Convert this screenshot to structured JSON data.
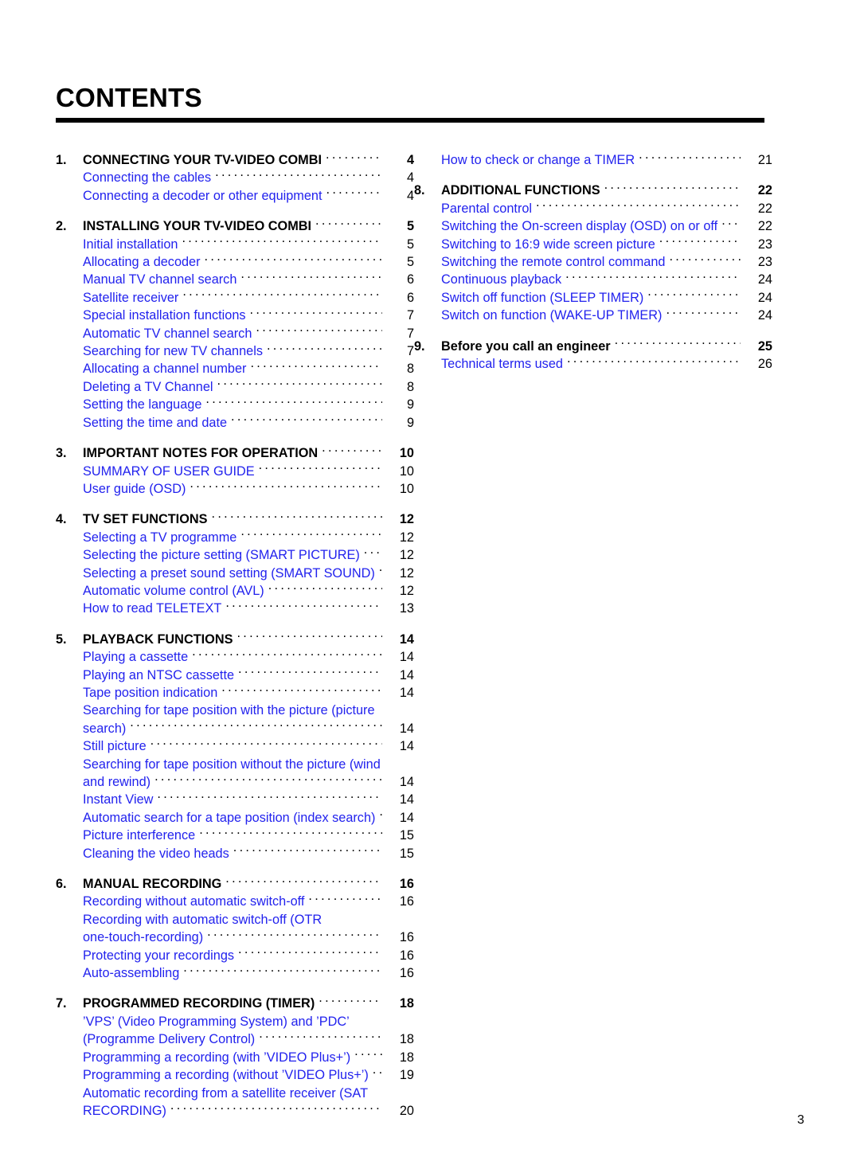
{
  "document": {
    "title": "CONTENTS",
    "folio": "3",
    "accent_blue": "#2222ee",
    "text_black": "#000000"
  },
  "columns": {
    "left": [
      {
        "number": "1.",
        "label": "CONNECTING YOUR TV-VIDEO COMBI",
        "page": "4",
        "items": [
          {
            "label": "Connecting the cables",
            "page": "4"
          },
          {
            "label": "Connecting a decoder or other equipment",
            "page": "4"
          }
        ]
      },
      {
        "number": "2.",
        "label": "INSTALLING YOUR TV-VIDEO COMBI",
        "page": "5",
        "items": [
          {
            "label": "Initial installation",
            "page": "5"
          },
          {
            "label": "Allocating a decoder",
            "page": "5"
          },
          {
            "label": "Manual TV channel search",
            "page": "6"
          },
          {
            "label": "Satellite receiver",
            "page": "6"
          },
          {
            "label": "Special installation functions",
            "page": "7"
          },
          {
            "label": "Automatic TV channel search",
            "page": "7"
          },
          {
            "label": "Searching for new TV channels",
            "page": "7"
          },
          {
            "label": "Allocating a channel number",
            "page": "8"
          },
          {
            "label": "Deleting a TV Channel",
            "page": "8"
          },
          {
            "label": "Setting the language",
            "page": "9"
          },
          {
            "label": "Setting the time and date",
            "page": "9"
          }
        ]
      },
      {
        "number": "3.",
        "label": "IMPORTANT NOTES FOR OPERATION",
        "page": "10",
        "items": [
          {
            "label": "SUMMARY OF USER GUIDE",
            "page": "10"
          },
          {
            "label": "User guide (OSD)",
            "page": "10"
          }
        ]
      },
      {
        "number": "4.",
        "label": "TV SET FUNCTIONS",
        "page": "12",
        "items": [
          {
            "label": "Selecting a TV programme",
            "page": "12"
          },
          {
            "label": "Selecting the picture setting (SMART PICTURE)",
            "page": "12"
          },
          {
            "label": "Selecting a preset sound setting (SMART SOUND)",
            "page": "12"
          },
          {
            "label": "Automatic volume control (AVL)",
            "page": "12"
          },
          {
            "label": "How to read TELETEXT",
            "page": "13"
          }
        ]
      },
      {
        "number": "5.",
        "label": "PLAYBACK FUNCTIONS",
        "page": "14",
        "items": [
          {
            "label": "Playing a cassette",
            "page": "14"
          },
          {
            "label": "Playing an NTSC cassette",
            "page": "14"
          },
          {
            "label": "Tape position indication",
            "page": "14"
          },
          {
            "label": "Searching for tape position with the picture (picture",
            "page": "",
            "wrap_first": true
          },
          {
            "label": "search)",
            "page": "14"
          },
          {
            "label": "Still picture",
            "page": "14"
          },
          {
            "label": "Searching for tape position without the picture (wind",
            "page": "",
            "wrap_first": true
          },
          {
            "label": "and rewind)",
            "page": "14"
          },
          {
            "label": "Instant View",
            "page": "14"
          },
          {
            "label": "Automatic search for a tape position (index search)",
            "page": "14"
          },
          {
            "label": "Picture interference",
            "page": "15"
          },
          {
            "label": "Cleaning the video heads",
            "page": "15"
          }
        ]
      },
      {
        "number": "6.",
        "label": "MANUAL RECORDING",
        "page": "16",
        "items": [
          {
            "label": "Recording without automatic switch-off",
            "page": "16"
          },
          {
            "label": "Recording with automatic switch-off (OTR",
            "page": "",
            "wrap_first": true
          },
          {
            "label": "one-touch-recording)",
            "page": "16"
          },
          {
            "label": "Protecting your recordings",
            "page": "16"
          },
          {
            "label": "Auto-assembling",
            "page": "16"
          }
        ]
      },
      {
        "number": "7.",
        "label": "PROGRAMMED RECORDING (TIMER)",
        "page": "18",
        "items": [
          {
            "label": "’VPS’ (Video Programming System) and ’PDC’",
            "page": "",
            "wrap_first": true
          },
          {
            "label": "(Programme Delivery Control)",
            "page": "18"
          },
          {
            "label": "Programming a recording (with ’VIDEO Plus+’)",
            "page": "18"
          },
          {
            "label": "Programming a recording (without ’VIDEO Plus+’)",
            "page": "19"
          },
          {
            "label": "Automatic recording from a satellite receiver (SAT",
            "page": "",
            "wrap_first": true
          },
          {
            "label": "RECORDING)",
            "page": "20"
          }
        ]
      }
    ],
    "right": [
      {
        "number": "",
        "label": "",
        "page": "",
        "continuation": true,
        "items": [
          {
            "label": "How to check or change a TIMER",
            "page": "21"
          }
        ]
      },
      {
        "number": "8.",
        "label": "ADDITIONAL FUNCTIONS",
        "page": "22",
        "items": [
          {
            "label": "Parental control",
            "page": "22"
          },
          {
            "label": "Switching the On-screen display (OSD) on or off",
            "page": "22"
          },
          {
            "label": "Switching to 16:9 wide screen picture",
            "page": "23"
          },
          {
            "label": "Switching the remote control command",
            "page": "23"
          },
          {
            "label": "Continuous playback",
            "page": "24"
          },
          {
            "label": "Switch off function (SLEEP TIMER)",
            "page": "24"
          },
          {
            "label": "Switch on function (WAKE-UP TIMER)",
            "page": "24"
          }
        ]
      },
      {
        "number": "9.",
        "label": "Before you call an engineer",
        "page": "25",
        "label_case": "mixed",
        "items": [
          {
            "label": "Technical terms used",
            "page": "26"
          }
        ]
      }
    ]
  }
}
